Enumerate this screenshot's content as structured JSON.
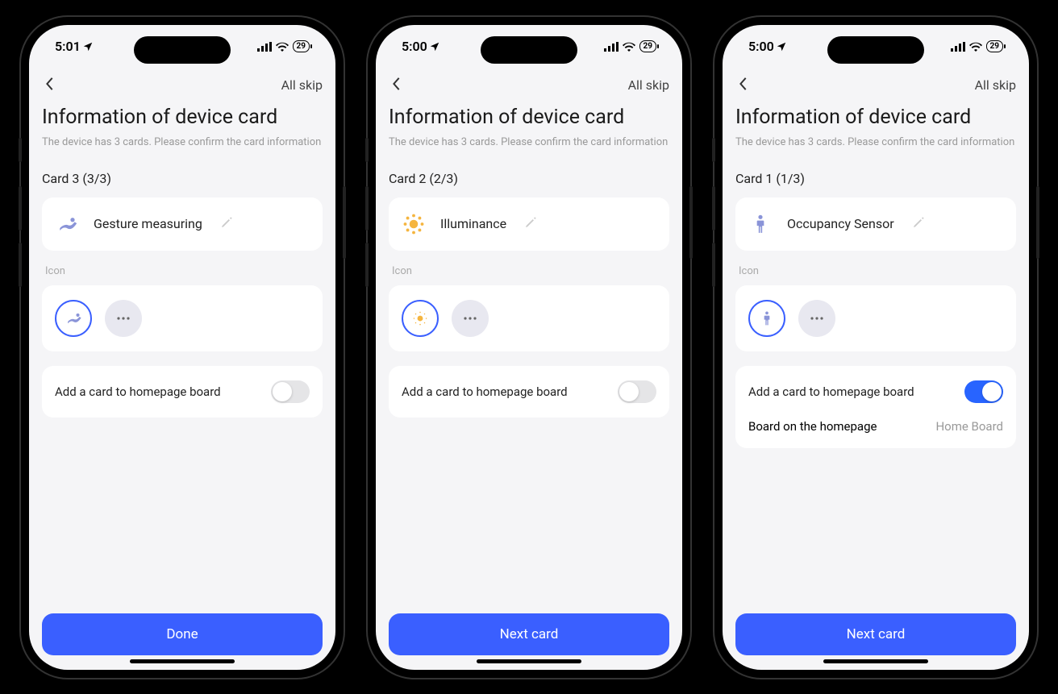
{
  "status": {
    "battery": "29"
  },
  "common": {
    "skip": "All skip",
    "title": "Information of device card",
    "subtitle": "The device has 3 cards. Please confirm the card information",
    "icon_section": "Icon",
    "add_card_label": "Add a card to homepage board",
    "board_label": "Board on the homepage",
    "board_value": "Home Board"
  },
  "phones": [
    {
      "time": "5:01",
      "card_label": "Card 3 (3/3)",
      "device_name": "Gesture measuring",
      "icon": "gesture",
      "toggle_on": false,
      "show_board_row": false,
      "button": "Done"
    },
    {
      "time": "5:00",
      "card_label": "Card 2 (2/3)",
      "device_name": "Illuminance",
      "icon": "sun",
      "toggle_on": false,
      "show_board_row": false,
      "button": "Next card"
    },
    {
      "time": "5:00",
      "card_label": "Card 1 (1/3)",
      "device_name": "Occupancy Sensor",
      "icon": "person",
      "toggle_on": true,
      "show_board_row": true,
      "button": "Next card"
    }
  ]
}
